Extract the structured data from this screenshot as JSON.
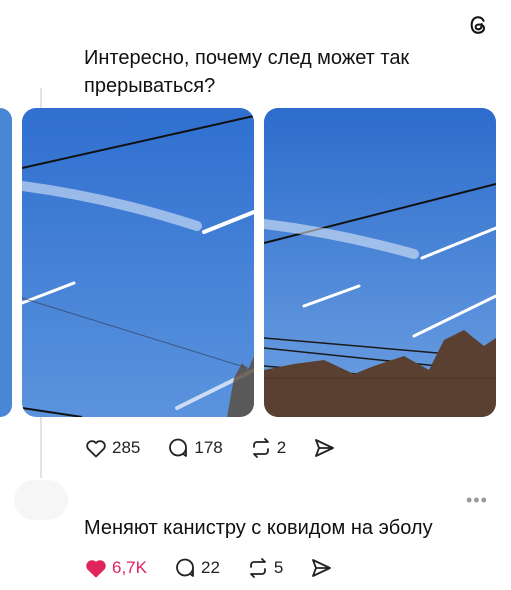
{
  "post": {
    "text": "Интересно, почему след может так прерываться?",
    "images": [
      {
        "alt": "sky with contrails and wires"
      },
      {
        "alt": "sky with contrails and trees"
      }
    ],
    "actions": {
      "likes": "285",
      "comments": "178",
      "reposts": "2"
    }
  },
  "reply": {
    "text": "Меняют канистру с ковидом на эболу",
    "more_label": "•••",
    "actions": {
      "likes": "6,7K",
      "comments": "22",
      "reposts": "5"
    }
  },
  "colors": {
    "sky": "#3a78d0",
    "liked": "#e0245e"
  },
  "icons": [
    "threads-logo-icon",
    "heart-icon",
    "comment-icon",
    "repost-icon",
    "share-icon",
    "more-icon"
  ]
}
